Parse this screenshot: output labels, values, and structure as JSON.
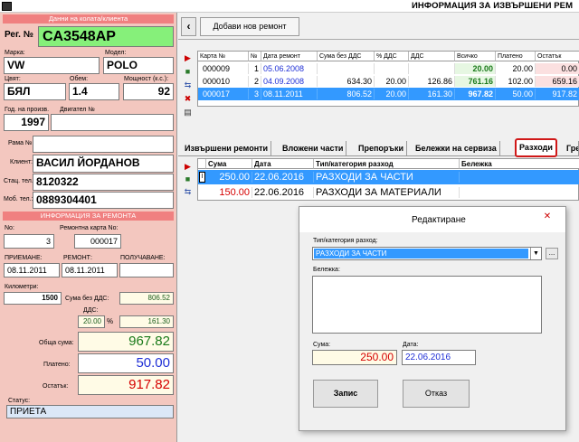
{
  "window": {
    "title": "ИНФОРМАЦИЯ ЗА ИЗВЪРШЕНИ РЕМ"
  },
  "client": {
    "section_label": "Данни на колата/клиента",
    "reg_label": "Рег. №",
    "reg_value": "CA3548AP",
    "make_label": "Марка:",
    "make_value": "VW",
    "model_label": "Модел:",
    "model_value": "POLO",
    "color_label": "Цвят:",
    "color_value": "БЯЛ",
    "volume_label": "Обем:",
    "volume_value": "1.4",
    "power_label": "Мощност (к.с.):",
    "power_value": "92",
    "year_label": "Год. на произв.",
    "year_value": "1997",
    "engine_label": "Двигател №",
    "engine_value": "",
    "frame_label": "Рама №",
    "frame_value": "",
    "client_label": "Клиент:",
    "client_value": "ВАСИЛ ЙОРДАНОВ",
    "phone_label": "Стац. тел.:",
    "phone_value": "8120322",
    "mobile_label": "Моб. тел.:",
    "mobile_value": "0889304401"
  },
  "repair": {
    "section_label": "ИНФОРМАЦИЯ ЗА РЕМОНТА",
    "no_label": "No:",
    "no_value": "3",
    "card_label": "Ремонтна карта No:",
    "card_value": "000017",
    "accept_label": "ПРИЕМАНЕ:",
    "accept_value": "08.11.2011",
    "repair_label": "РЕМОНТ:",
    "repair_value": "08.11.2011",
    "receive_label": "ПОЛУЧАВАНЕ:",
    "receive_value": "",
    "km_label": "Километри:",
    "km_value": "1500",
    "sum_no_vat_label": "Сума без ДДС:",
    "sum_no_vat_value": "806.52",
    "vat_label": "ДДС:",
    "vat_pct": "20.00",
    "pct_sign": "%",
    "vat_value": "161.30",
    "total_label": "Обща сума:",
    "total_value": "967.82",
    "paid_label": "Платено:",
    "paid_value": "50.00",
    "remaining_label": "Остатък:",
    "remaining_value": "917.82",
    "status_label": "Статус:",
    "status_value": "ПРИЕТА"
  },
  "toolbar": {
    "back_label": "‹",
    "add_label": "Добави нов ремонт"
  },
  "repairs_table": {
    "headers": [
      "Карта №",
      "№",
      "Дата ремонт",
      "Сума без ДДС",
      "% ДДС",
      "ДДС",
      "Всичко",
      "Платено",
      "Остатък"
    ],
    "rows": [
      [
        "000009",
        "1",
        "05.06.2008",
        "",
        "",
        "",
        "20.00",
        "20.00",
        "0.00"
      ],
      [
        "000010",
        "2",
        "04.09.2008",
        "634.30",
        "20.00",
        "126.86",
        "761.16",
        "102.00",
        "659.16"
      ],
      [
        "000017",
        "3",
        "08.11.2011",
        "806.52",
        "20.00",
        "161.30",
        "967.82",
        "50.00",
        "917.82"
      ]
    ]
  },
  "tabs": [
    "Извършени ремонти",
    "Вложени части",
    "Препоръки",
    "Бележки на сервиза",
    "Разходи",
    "Гре"
  ],
  "expenses_table": {
    "headers": [
      "Сума",
      "Дата",
      "Тип/категория разход",
      "Бележка"
    ],
    "rows": [
      [
        "250.00",
        "22.06.2016",
        "РАЗХОДИ ЗА ЧАСТИ",
        ""
      ],
      [
        "150.00",
        "22.06.2016",
        "РАЗХОДИ ЗА МАТЕРИАЛИ",
        ""
      ]
    ]
  },
  "dialog": {
    "title": "Редактиране",
    "close": "✕",
    "type_label": "Тип/категория разход:",
    "type_value": "РАЗХОДИ ЗА ЧАСТИ",
    "browse": "...",
    "note_label": "Бележка:",
    "note_value": "",
    "sum_label": "Сума:",
    "sum_value": "250.00",
    "date_label": "Дата:",
    "date_value": "22.06.2016",
    "save_label": "Запис",
    "cancel_label": "Отказ"
  },
  "colors": {
    "pink": "#f3c7bf",
    "section": "#f08080",
    "selected": "#3399ff",
    "green": "#86f07a"
  }
}
